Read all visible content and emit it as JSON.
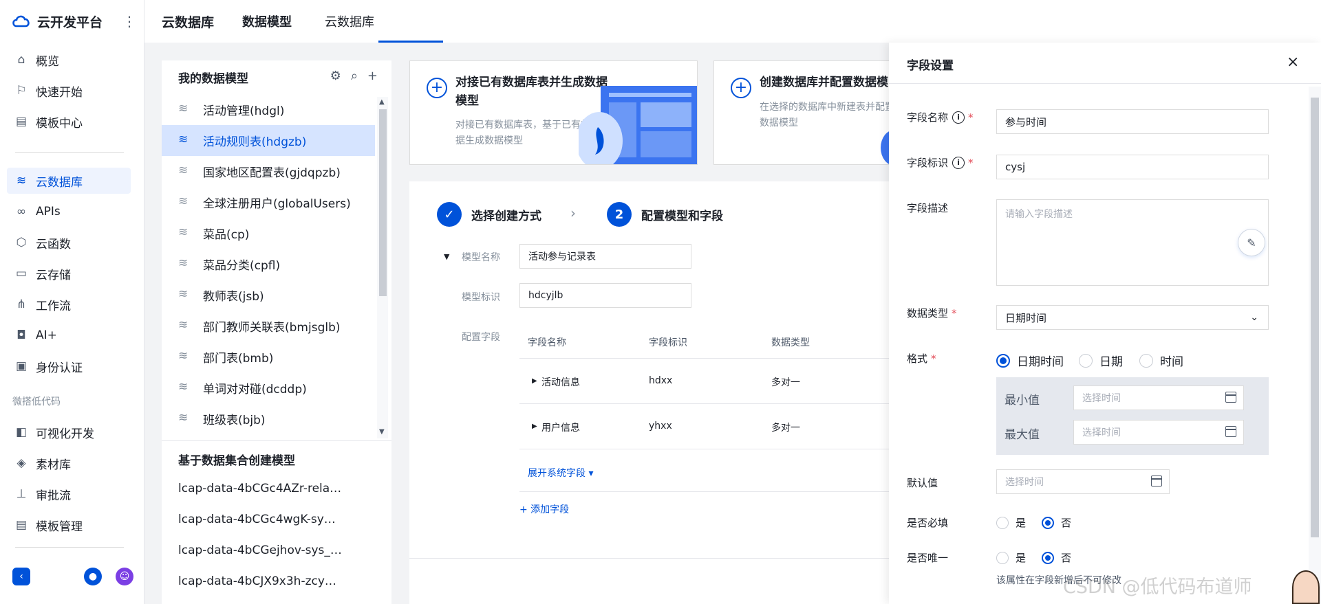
{
  "brand": {
    "title": "云开发平台",
    "more": "⋮"
  },
  "nav": {
    "items": [
      {
        "label": "概览",
        "icon": "home-icon"
      },
      {
        "label": "快速开始",
        "icon": "flag-icon"
      },
      {
        "label": "模板中心",
        "icon": "template-icon"
      },
      {
        "label": "云数据库",
        "icon": "database-icon"
      },
      {
        "label": "APIs",
        "icon": "link-icon"
      },
      {
        "label": "云函数",
        "icon": "function-icon"
      },
      {
        "label": "云存储",
        "icon": "folder-icon"
      },
      {
        "label": "工作流",
        "icon": "workflow-icon"
      },
      {
        "label": "AI+",
        "icon": "robot-icon"
      },
      {
        "label": "身份认证",
        "icon": "id-card-icon"
      },
      {
        "label": "可视化开发",
        "icon": "layout-icon"
      },
      {
        "label": "素材库",
        "icon": "shapes-icon"
      },
      {
        "label": "审批流",
        "icon": "stamp-icon"
      },
      {
        "label": "模板管理",
        "icon": "template-icon"
      }
    ],
    "section": "微搭低代码"
  },
  "top_tabs": [
    "云数据库",
    "数据模型",
    "云数据库"
  ],
  "model_panel": {
    "title": "我的数据模型",
    "items": [
      "活动管理(hdgl)",
      "活动规则表(hdgzb)",
      "国家地区配置表(gjdqpzb)",
      "全球注册用户(globalUsers)",
      "菜品(cp)",
      "菜品分类(cpfl)",
      "教师表(jsb)",
      "部门教师关联表(bmjsglb)",
      "部门表(bmb)",
      "单词对对碰(dcddp)",
      "班级表(bjb)"
    ],
    "section2_title": "基于数据集合创建模型",
    "section2_items": [
      "lcap-data-4bCGc4AZr-rela…",
      "lcap-data-4bCGc4wgK-sy…",
      "lcap-data-4bCGejhov-sys_…",
      "lcap-data-4bCJX9x3h-zcy…"
    ]
  },
  "cards": [
    {
      "title": "对接已有数据库表并生成数据模型",
      "desc": "对接已有数据库表，基于已有的数据生成数据模型"
    },
    {
      "title": "创建数据库并配置数据模",
      "desc": "在选择的数据库中新建表并配置数据模型"
    }
  ],
  "wizard": {
    "step1": "选择创建方式",
    "step2_num": "2",
    "step2": "配置模型和字段",
    "model_name_label": "模型名称",
    "model_name": "活动参与记录表",
    "model_id_label": "模型标识",
    "model_id": "hdcyjlb",
    "fields_label": "配置字段",
    "columns": [
      "字段名称",
      "字段标识",
      "数据类型"
    ],
    "rows": [
      {
        "name": "活动信息",
        "id": "hdxx",
        "type": "多对一"
      },
      {
        "name": "用户信息",
        "id": "yhxx",
        "type": "多对一"
      }
    ],
    "expand_link": "展开系统字段 ▾",
    "add_link": "+ 添加字段"
  },
  "drawer": {
    "title": "字段设置",
    "field_name_label": "字段名称",
    "field_name": "参与时间",
    "field_id_label": "字段标识",
    "field_id": "cysj",
    "desc_label": "字段描述",
    "desc_placeholder": "请输入字段描述",
    "type_label": "数据类型",
    "type_value": "日期时间",
    "format_label": "格式",
    "format_options": [
      "日期时间",
      "日期",
      "时间"
    ],
    "format_selected": "日期时间",
    "min_label": "最小值",
    "max_label": "最大值",
    "time_placeholder": "选择时间",
    "default_label": "默认值",
    "required_label": "是否必填",
    "unique_label": "是否唯一",
    "yes": "是",
    "no": "否",
    "required_value": "否",
    "unique_value": "否",
    "hint": "该属性在字段新增后不可修改"
  },
  "watermark": "CSDN @低代码布道师",
  "colors": {
    "accent": "#0052d9",
    "selected_bg": "#d6e4ff",
    "required": "#e34d59"
  }
}
